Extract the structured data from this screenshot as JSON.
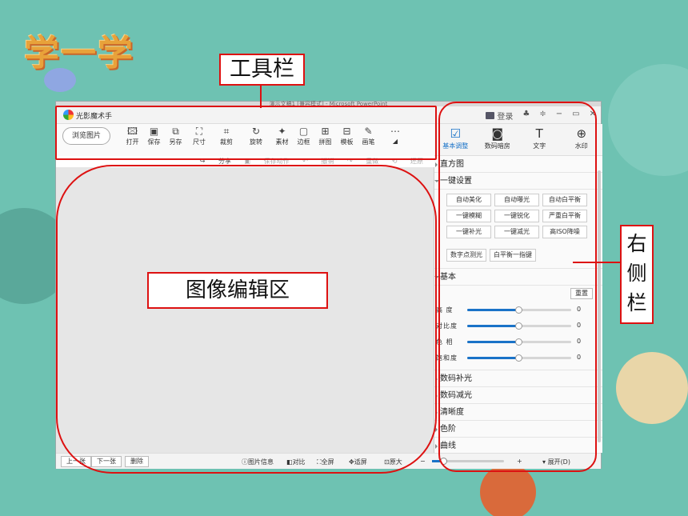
{
  "slide": {
    "heading": "学一学",
    "label_toolbar": "工具栏",
    "label_editor": "图像编辑区",
    "label_right_chars": [
      "右",
      "侧",
      "栏"
    ],
    "accent_color": "#d11111"
  },
  "window": {
    "ppt_title": "演示文稿1 [兼容模式] - Microsoft PowerPoint",
    "app_name": "光影魔术手",
    "login": "登录"
  },
  "toolbar": {
    "browse": "浏览图片",
    "tools": [
      {
        "label": "打开",
        "icon": "open-icon"
      },
      {
        "label": "保存",
        "icon": "save-icon"
      },
      {
        "label": "另存",
        "icon": "save-as-icon"
      },
      {
        "label": "尺寸",
        "icon": "resize-icon"
      },
      {
        "label": "裁剪",
        "icon": "crop-icon"
      },
      {
        "label": "旋转",
        "icon": "rotate-icon"
      },
      {
        "label": "素材",
        "icon": "material-icon"
      },
      {
        "label": "边框",
        "icon": "border-icon"
      },
      {
        "label": "拼图",
        "icon": "collage-icon"
      },
      {
        "label": "模板",
        "icon": "template-icon"
      },
      {
        "label": "画笔",
        "icon": "brush-icon"
      },
      {
        "label": "",
        "icon": "more-icon"
      }
    ]
  },
  "right_tabs": [
    {
      "label": "基本调整",
      "icon": "adjust-icon"
    },
    {
      "label": "数码暗房",
      "icon": "darkroom-icon"
    },
    {
      "label": "文字",
      "icon": "text-icon"
    },
    {
      "label": "水印",
      "icon": "watermark-icon"
    }
  ],
  "actions": [
    "分享",
    "保存动作",
    "撤销",
    "重做",
    "还原"
  ],
  "panel": {
    "histogram": "直方图",
    "one_click": "一键设置",
    "presets": [
      "自动美化",
      "自动曝光",
      "自动白平衡",
      "一键模糊",
      "一键锐化",
      "严重白平衡",
      "一键补光",
      "一键减光",
      "高ISO降噪"
    ],
    "presets_row2": [
      "数字点测光",
      "白平衡一指键"
    ],
    "basic": "基本",
    "reset": "重置",
    "sliders": [
      {
        "label": "高 度",
        "value": "0",
        "level": 0.5
      },
      {
        "label": "对比度",
        "value": "0",
        "level": 0.5
      },
      {
        "label": "色 相",
        "value": "0",
        "level": 0.5
      },
      {
        "label": "饱和度",
        "value": "0",
        "level": 0.5
      }
    ],
    "sections": [
      "数码补光",
      "数码减光",
      "清晰度",
      "色阶",
      "曲线"
    ]
  },
  "bottom": {
    "prev": "上一张",
    "next": "下一张",
    "delete": "删除",
    "info": "图片信息",
    "compare": "对比",
    "fullscreen": "全屏",
    "fit": "适屏",
    "original": "原大",
    "minus": "−",
    "plus": "+",
    "expand": "展开",
    "expand_key": "(D)",
    "zoom_level": 0.15
  }
}
